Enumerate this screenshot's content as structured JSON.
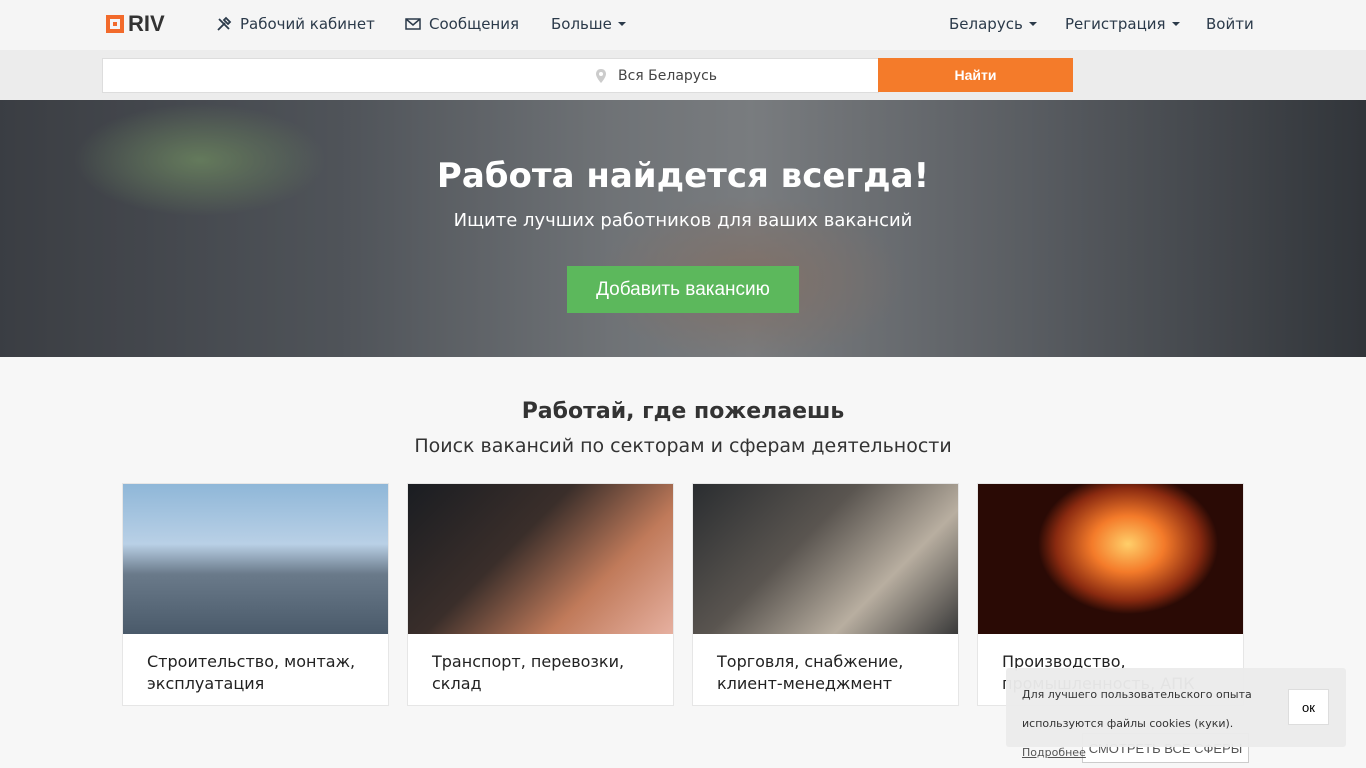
{
  "logo": {
    "text": "RIV"
  },
  "nav": {
    "cabinet": "Рабочий кабинет",
    "messages": "Сообщения",
    "more": "Больше",
    "country": "Беларусь",
    "register": "Регистрация",
    "login": "Войти"
  },
  "search": {
    "query_value": "",
    "location": "Вся Беларусь",
    "button": "Найти"
  },
  "hero": {
    "title": "Работа найдется всегда!",
    "subtitle": "Ищите лучших работников для ваших вакансий",
    "button": "Добавить вакансию"
  },
  "sectors": {
    "title": "Работай, где пожелаешь",
    "subtitle": "Поиск вакансий по секторам и сферам деятельности",
    "items": [
      {
        "label": "Строительство, монтаж, эксплуатация"
      },
      {
        "label": "Транспорт, перевозки, склад"
      },
      {
        "label": "Торговля, снабжение, клиент-менеджмент"
      },
      {
        "label": "Производство, промышленность, АПК"
      }
    ],
    "see_all": "СМОТРЕТЬ ВСЕ СФЕРЫ"
  },
  "cookie": {
    "text": "Для лучшего пользовательского опыта используются файлы cookies (куки).",
    "link": "Подробнее",
    "button": "ок"
  },
  "colors": {
    "accent": "#f47b2a",
    "primary_button": "#5cb85c",
    "nav_text": "#2b3a4a"
  }
}
